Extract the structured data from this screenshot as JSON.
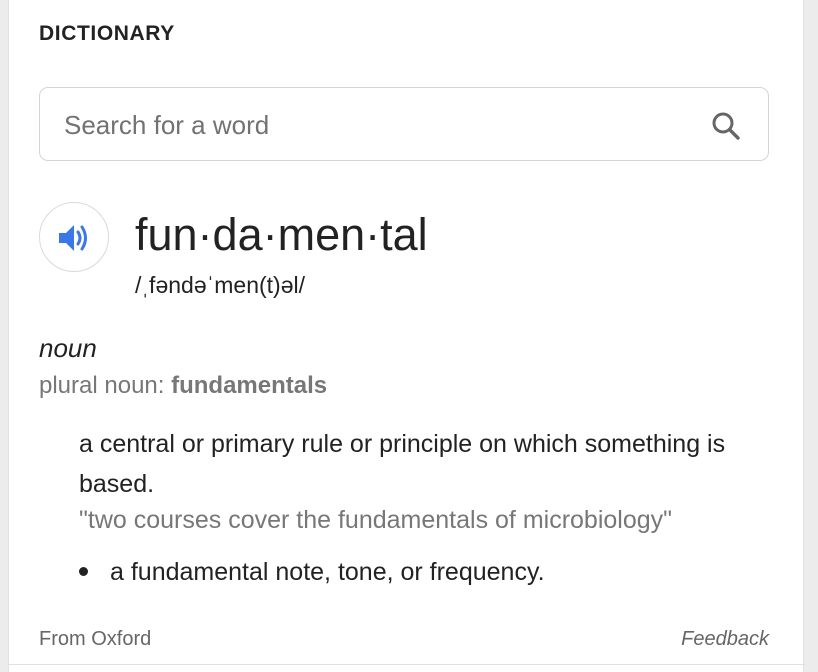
{
  "header": {
    "title": "DICTIONARY"
  },
  "search": {
    "placeholder": "Search for a word",
    "value": ""
  },
  "entry": {
    "headword": "fun·da·men·tal",
    "phonetic": "/ˌfəndəˈmen(t)əl/",
    "part_of_speech": "noun",
    "plural_label": "plural noun:",
    "plural_form": "fundamentals",
    "definition": "a central or primary rule or principle on which something is based.",
    "example": "\"two courses cover the fundamentals of microbiology\"",
    "subsense": "a fundamental note, tone, or frequency."
  },
  "footer": {
    "source": "From Oxford",
    "feedback": "Feedback"
  },
  "colors": {
    "audio_icon": "#3b78e7",
    "muted_text": "#777777"
  },
  "icons": {
    "audio": "speaker-icon",
    "search": "search-icon"
  }
}
